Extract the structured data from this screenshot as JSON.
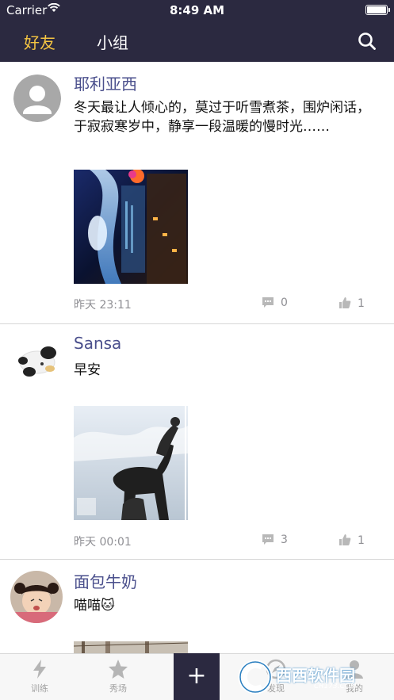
{
  "status_bar": {
    "carrier": "Carrier",
    "time": "8:49 AM"
  },
  "nav": {
    "tabs": [
      {
        "label": "好友",
        "active": true
      },
      {
        "label": "小组",
        "active": false
      }
    ],
    "accent_color": "#f5c542",
    "bar_color": "#2b2940",
    "search_icon": "search-icon"
  },
  "posts": [
    {
      "username": "耶利亚西",
      "text": "冬天最让人倾心的，莫过于听雪煮茶，围炉闲话，于寂寂寒岁中，静享一段温暖的慢时光……",
      "time": "昨天 23:11",
      "comments": "0",
      "likes": "1"
    },
    {
      "username": "Sansa",
      "text": "早安",
      "time": "昨天 00:01",
      "comments": "3",
      "likes": "1"
    },
    {
      "username": "面包牛奶",
      "text": "喵喵🐱"
    }
  ],
  "tabbar": {
    "items": [
      {
        "label": "训练",
        "icon": "lightning-icon"
      },
      {
        "label": "秀场",
        "icon": "star-icon"
      },
      {
        "label": "发现",
        "icon": "compass-icon"
      },
      {
        "label": "我的",
        "icon": "person-icon"
      }
    ],
    "plus_label": "+"
  },
  "watermark": {
    "text": "西西软件园",
    "url": "CR173.COM"
  }
}
